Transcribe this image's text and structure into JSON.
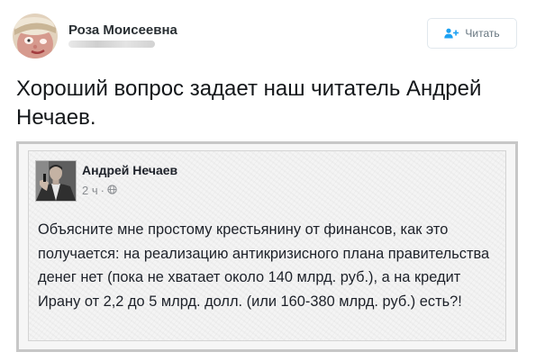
{
  "tweet": {
    "author_name": "Роза Моисеевна",
    "follow_label": "Читать",
    "text": "Хороший вопрос задает наш читатель Андрей Нечаев."
  },
  "embedded_post": {
    "author_name": "Андрей Нечаев",
    "time": "2 ч",
    "separator": "·",
    "text": "Объясните мне простому крестьянину от финансов, как это получается: на реализацию антикризисного плана правительства денег нет (пока не хватает около 140 млрд. руб.), а на кредит Ирану от 2,2 до 5 млрд. долл. (или 160-380 млрд. руб.) есть?!"
  },
  "icons": {
    "follow": "user-plus-icon",
    "privacy": "globe-icon"
  },
  "colors": {
    "accent": "#1da1f2",
    "text": "#14171a",
    "muted": "#66757f"
  }
}
